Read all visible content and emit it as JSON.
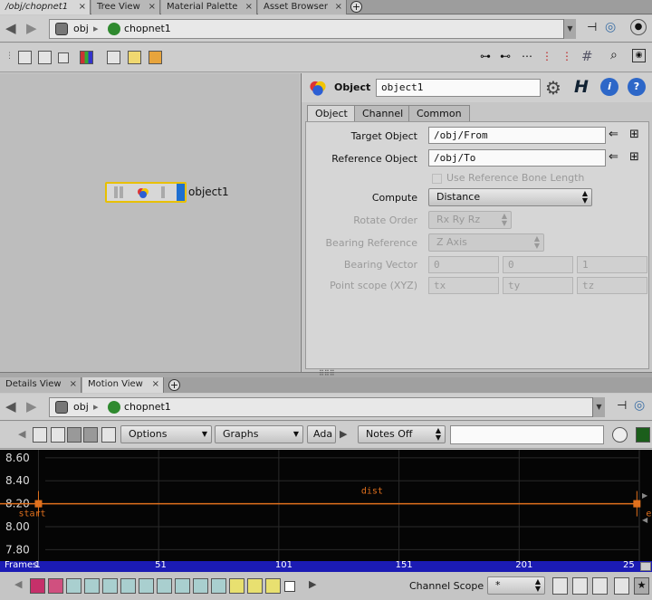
{
  "top_tabs": [
    {
      "label": "/obj/chopnet1",
      "active": true
    },
    {
      "label": "Tree View",
      "active": false
    },
    {
      "label": "Material Palette",
      "active": false
    },
    {
      "label": "Asset Browser",
      "active": false
    }
  ],
  "path": {
    "root": "obj",
    "child": "chopnet1"
  },
  "network": {
    "node_label": "object1"
  },
  "params": {
    "node_type": "Object",
    "node_name": "object1",
    "help_icon": "?",
    "tabs": [
      "Object",
      "Channel",
      "Common"
    ],
    "target_object_label": "Target Object",
    "target_object_value": "/obj/From",
    "reference_object_label": "Reference Object",
    "reference_object_value": "/obj/To",
    "use_ref_bone_label": "Use Reference Bone Length",
    "compute_label": "Compute",
    "compute_value": "Distance",
    "rotate_order_label": "Rotate Order",
    "rotate_order_value": "Rx Ry Rz",
    "bearing_ref_label": "Bearing Reference",
    "bearing_ref_value": "Z Axis",
    "bearing_vector_label": "Bearing Vector",
    "bearing_vector_values": [
      "0",
      "0",
      "1"
    ],
    "point_scope_label": "Point scope (XYZ)",
    "point_scope_values": [
      "tx",
      "ty",
      "tz"
    ]
  },
  "lower_tabs": [
    {
      "label": "Details View",
      "active": false
    },
    {
      "label": "Motion View",
      "active": true
    }
  ],
  "motion_toolbar": {
    "options_label": "Options",
    "graphs_label": "Graphs",
    "ada_label": "Ada",
    "notes_label": "Notes Off"
  },
  "chart_data": {
    "type": "line",
    "series": [
      {
        "name": "dist",
        "x": [
          1,
          250
        ],
        "values": [
          8.2,
          8.2
        ]
      }
    ],
    "y_ticks": [
      "8.60",
      "8.40",
      "8.20",
      "8.00",
      "7.80"
    ],
    "x_ticks": [
      "1",
      "51",
      "101",
      "151",
      "201",
      "25"
    ],
    "ylim": [
      7.7,
      8.67
    ],
    "xlim": [
      -15,
      251
    ],
    "markers": [
      {
        "label": "start",
        "x": 1
      },
      {
        "label": "end",
        "x": 250
      }
    ],
    "grid": true
  },
  "timebar": {
    "label": "Frames"
  },
  "bottom": {
    "channel_scope_label": "Channel Scope",
    "channel_scope_value": "*"
  },
  "colors": {
    "accent_blue": "#1b1bb4",
    "curve": "#e0701d",
    "node_selected": "#e8c000"
  }
}
